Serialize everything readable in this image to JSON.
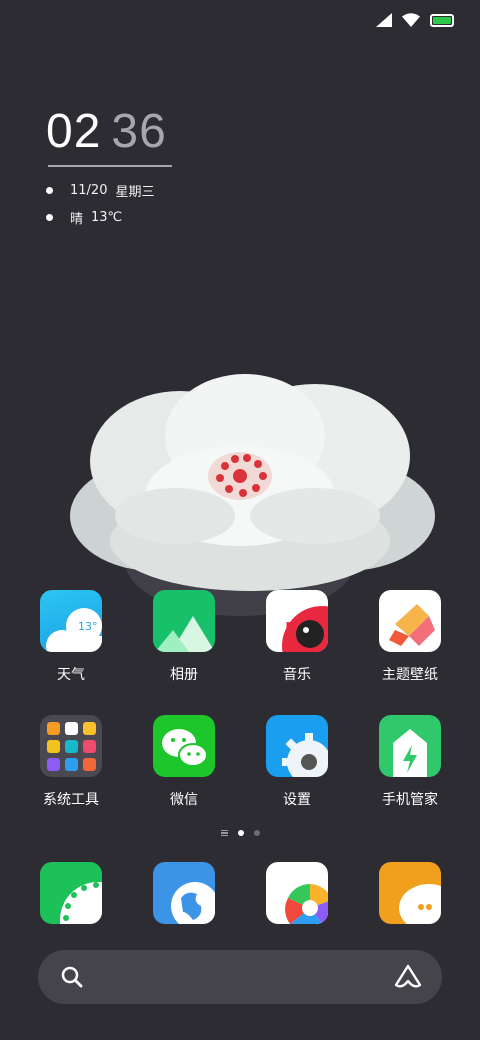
{
  "status_bar": {
    "icons": [
      "signal-icon",
      "wifi-icon",
      "battery-icon"
    ],
    "battery_color": "#2ec84a"
  },
  "clock_widget": {
    "hour": "02",
    "minute": "36",
    "date": "11/20",
    "weekday": "星期三",
    "weather": "晴",
    "temperature": "13℃"
  },
  "apps": [
    {
      "label": "天气",
      "icon": "weather-icon",
      "badge": "13°"
    },
    {
      "label": "相册",
      "icon": "gallery-icon"
    },
    {
      "label": "音乐",
      "icon": "music-icon"
    },
    {
      "label": "主题壁纸",
      "icon": "themes-icon"
    },
    {
      "label": "系统工具",
      "icon": "folder-icon"
    },
    {
      "label": "微信",
      "icon": "wechat-icon"
    },
    {
      "label": "设置",
      "icon": "settings-icon"
    },
    {
      "label": "手机管家",
      "icon": "security-icon"
    }
  ],
  "dock": [
    {
      "icon": "phone-icon"
    },
    {
      "icon": "browser-icon"
    },
    {
      "icon": "camera-icon"
    },
    {
      "icon": "messages-icon"
    }
  ],
  "pager": {
    "pages": 2,
    "active": 1
  },
  "search_bar": {
    "left_icon": "search-icon",
    "right_icon": "assistant-icon"
  },
  "colors": {
    "background": "#2e2c33",
    "weather": "#2cb8ee",
    "gallery": "#19c06a",
    "music_accent": "#e8293f",
    "themes": "#f05a3a",
    "wechat": "#1dc62a",
    "settings": "#1a9ef0",
    "security": "#2fc86a",
    "browser": "#3b94e6",
    "messages": "#f1a01e"
  }
}
